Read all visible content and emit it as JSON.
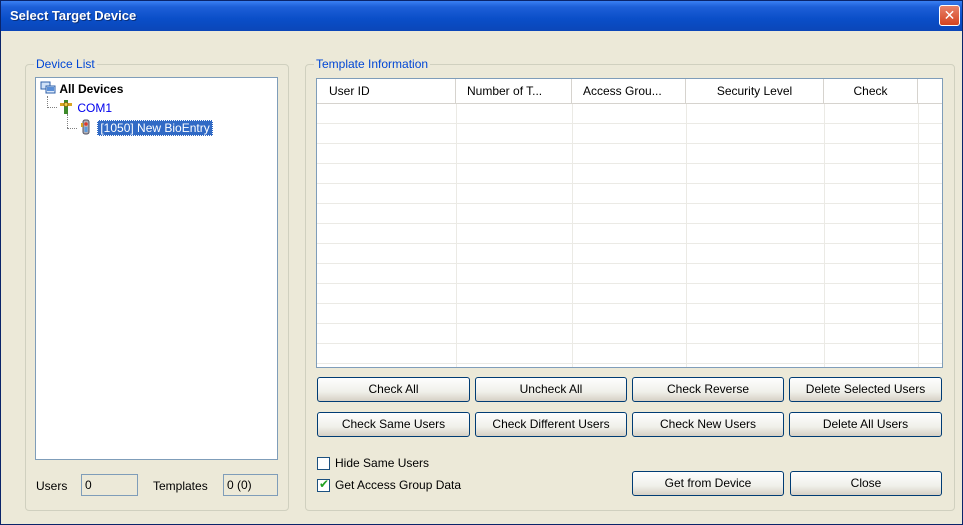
{
  "window": {
    "title": "Select Target Device",
    "close_glyph": "✕"
  },
  "device_list": {
    "title": "Device List",
    "tree": {
      "root": "All Devices",
      "port": "COM1",
      "device": "[1050] New BioEntry"
    },
    "users_label": "Users",
    "users_value": "0",
    "templates_label": "Templates",
    "templates_value": "0 (0)"
  },
  "template_info": {
    "title": "Template Information",
    "columns": [
      "User ID",
      "Number of T...",
      "Access Grou...",
      "Security Level",
      "Check"
    ],
    "rows": []
  },
  "buttons": {
    "check_all": "Check All",
    "uncheck_all": "Uncheck All",
    "check_reverse": "Check Reverse",
    "delete_selected": "Delete Selected Users",
    "check_same": "Check Same Users",
    "check_different": "Check Different Users",
    "check_new": "Check New Users",
    "delete_all": "Delete All Users",
    "get_from_device": "Get from Device",
    "close": "Close"
  },
  "options": {
    "hide_same_users": {
      "label": "Hide Same Users",
      "checked": false
    },
    "get_access_group_data": {
      "label": "Get Access Group Data",
      "checked": true
    }
  },
  "icons": {
    "root": "computer-network-icon",
    "port": "serial-port-icon",
    "device": "biometric-device-icon"
  },
  "colors": {
    "titlebar": "#0a4ec8",
    "accent": "#0046d5",
    "selection": "#316ac5"
  }
}
